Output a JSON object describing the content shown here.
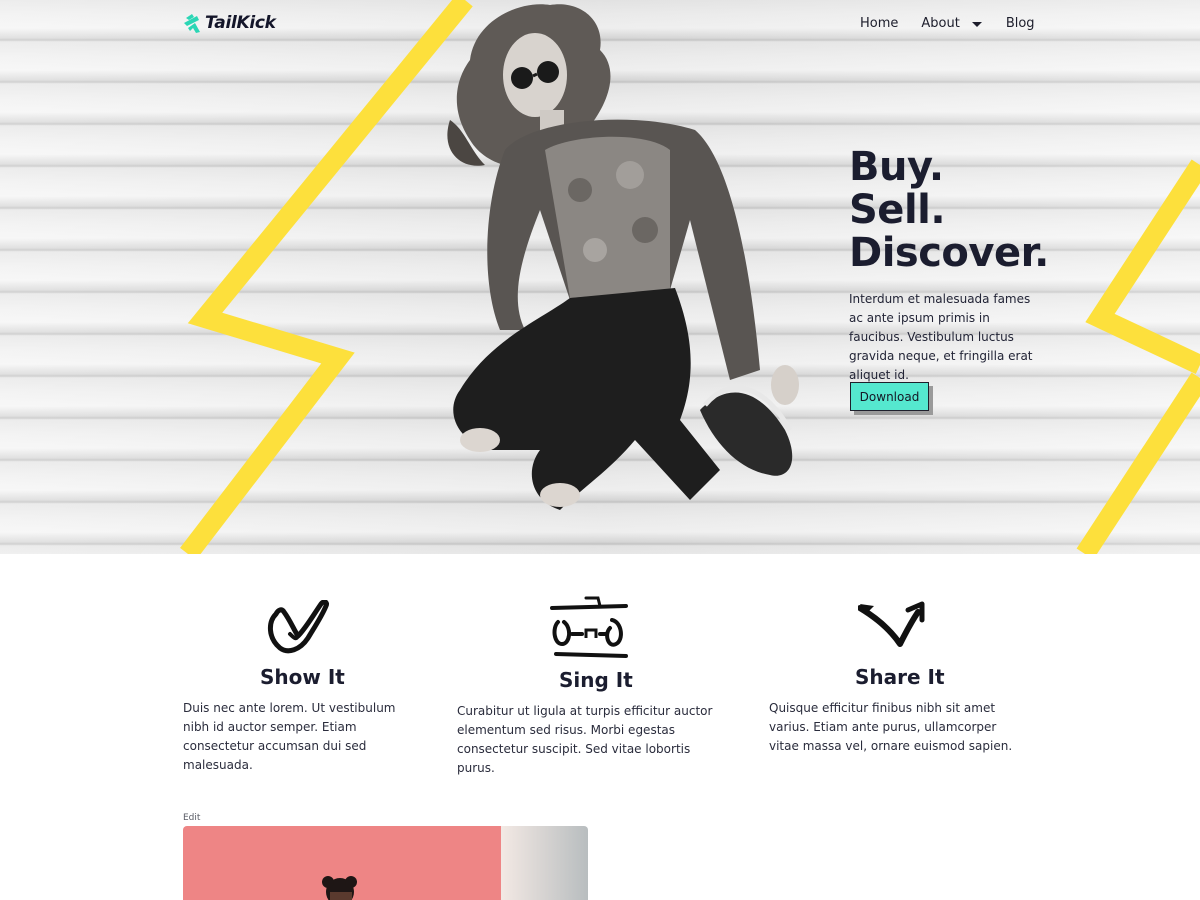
{
  "brand": {
    "name": "TailKick",
    "accent": "#55e8cf",
    "bolt_color": "#fde03c"
  },
  "nav": {
    "items": [
      {
        "label": "Home"
      },
      {
        "label": "About"
      },
      {
        "label": "Blog"
      }
    ]
  },
  "hero": {
    "title_lines": [
      "Buy.",
      "Sell.",
      "Discover."
    ],
    "description": "Interdum et malesuada fames ac ante ipsum primis in faucibus. Vestibulum luctus gravida neque, et fringilla erat aliquet id.",
    "button_label": "Download"
  },
  "features": [
    {
      "icon": "heart-check-icon",
      "title": "Show It",
      "text": "Duis nec ante lorem. Ut vestibulum nibh id auctor semper. Etiam consectetur accumsan dui sed malesuada."
    },
    {
      "icon": "boombox-icon",
      "title": "Sing It",
      "text": "Curabitur ut ligula at turpis efficitur auctor elementum sed risus. Morbi egestas consectetur suscipit. Sed vitae lobortis purus."
    },
    {
      "icon": "share-arrow-icon",
      "title": "Share It",
      "text": "Quisque efficitur finibus nibh sit amet varius. Etiam ante purus, ullamcorper vitae massa vel, ornare euismod sapien."
    }
  ],
  "edit_label": "Edit"
}
